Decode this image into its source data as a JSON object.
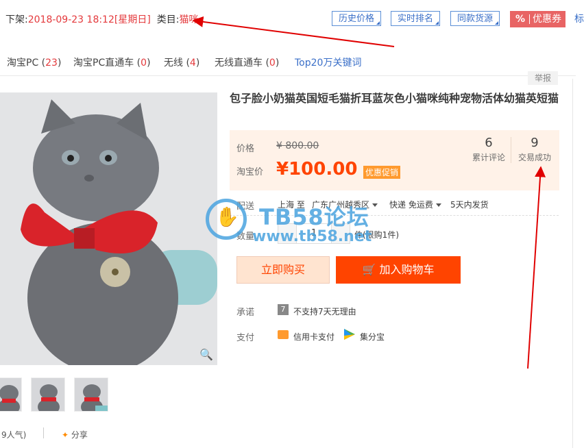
{
  "top": {
    "offshelf_label": "下架:",
    "offshelf_time": "2018-09-23 18:12[星期日]",
    "category_label": "类目:",
    "category_value": "猫咪",
    "tools": [
      "历史价格",
      "实时排名",
      "同款货源"
    ],
    "coupon_pct": "%",
    "coupon_label": "优惠券",
    "extra": "标"
  },
  "stats": [
    {
      "label": "淘宝PC (",
      "num": "23",
      "close": ")"
    },
    {
      "label": "淘宝PC直通车 (",
      "num": "0",
      "close": ")"
    },
    {
      "label": "无线 (",
      "num": "4",
      "close": ")"
    },
    {
      "label": "无线直通车 (",
      "num": "0",
      "close": ")"
    }
  ],
  "stats_link": "Top20万关键词",
  "report": "举报",
  "product": {
    "title": "包子脸小奶猫英国短毛猫折耳蓝灰色小猫咪纯种宠物活体幼猫英短猫",
    "price_label": "价格",
    "old_price": "¥ 800.00",
    "tb_price_label": "淘宝价",
    "new_price": "¥100.00",
    "promo": "优惠促销",
    "reviews_num": "6",
    "reviews_label": "累计评论",
    "deals_num": "9",
    "deals_label": "交易成功"
  },
  "delivery": {
    "label": "配送",
    "from": "上海 至",
    "to": "广东广州越秀区",
    "express": "快递 免运费",
    "ship": "5天内发货"
  },
  "quantity": {
    "label": "数量",
    "value": "1",
    "note": "件(限购1件)"
  },
  "buttons": {
    "buy": "立即购买",
    "cart": "加入购物车"
  },
  "promise": {
    "label": "承诺",
    "text": "不支持7天无理由"
  },
  "payment": {
    "label": "支付",
    "method1": "信用卡支付",
    "method2": "集分宝"
  },
  "bottom": {
    "popularity": "9人气)",
    "share": "分享"
  },
  "watermark": {
    "line1": "TB58论坛",
    "line2": "www.tb58.net"
  },
  "colors": {
    "accent": "#ff4400",
    "link": "#3a6fc8",
    "red": "#e4393c"
  }
}
